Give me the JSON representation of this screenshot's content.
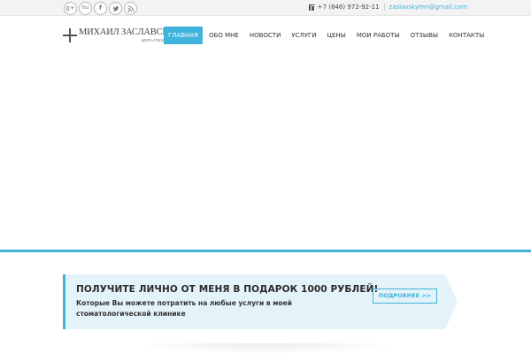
{
  "social": {
    "items": [
      {
        "name": "google-plus",
        "glyph": "g+"
      },
      {
        "name": "youtube",
        "glyph": "You"
      },
      {
        "name": "facebook",
        "glyph": "f"
      },
      {
        "name": "twitter",
        "glyph": ""
      },
      {
        "name": "rss",
        "glyph": ""
      }
    ]
  },
  "contacts": {
    "phone": "+7 (846) 972-92-11",
    "email": "zaslavskymn@gmail.com"
  },
  "logo": {
    "name": "МИХАИЛ ЗАСЛАВСКИЙ",
    "subtitle": "врач-стоматолог"
  },
  "nav": {
    "items": [
      {
        "label": "ГЛАВНАЯ",
        "active": true
      },
      {
        "label": "ОБО МНЕ",
        "active": false
      },
      {
        "label": "НОВОСТИ",
        "active": false
      },
      {
        "label": "УСЛУГИ",
        "active": false
      },
      {
        "label": "ЦЕНЫ",
        "active": false
      },
      {
        "label": "МОИ РАБОТЫ",
        "active": false
      },
      {
        "label": "ОТЗЫВЫ",
        "active": false
      },
      {
        "label": "КОНТАКТЫ",
        "active": false
      }
    ]
  },
  "promo": {
    "title": "ПОЛУЧИТЕ ЛИЧНО ОТ МЕНЯ В ПОДАРОК 1000 РУБЛЕЙ!",
    "text": "Которые Вы можете потратить на любые услуги в моей стоматологической клинике",
    "button": "ПОДРОБНЕЕ >>"
  },
  "colors": {
    "accent": "#3fb3d9",
    "promo_bg": "#e4f3fa",
    "topbar_bg": "#f3f3f3"
  }
}
